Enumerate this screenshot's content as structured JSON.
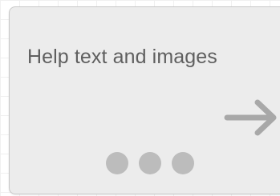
{
  "card": {
    "title": "Help text and images"
  },
  "navigation": {
    "next_icon": "arrow-right-icon",
    "pager_dots": 3
  },
  "colors": {
    "card_background": "#ececec",
    "card_border": "#c8c8c8",
    "title_text": "#5f5f5f",
    "arrow": "#a8a8a8",
    "dot": "#bcbcbc"
  }
}
